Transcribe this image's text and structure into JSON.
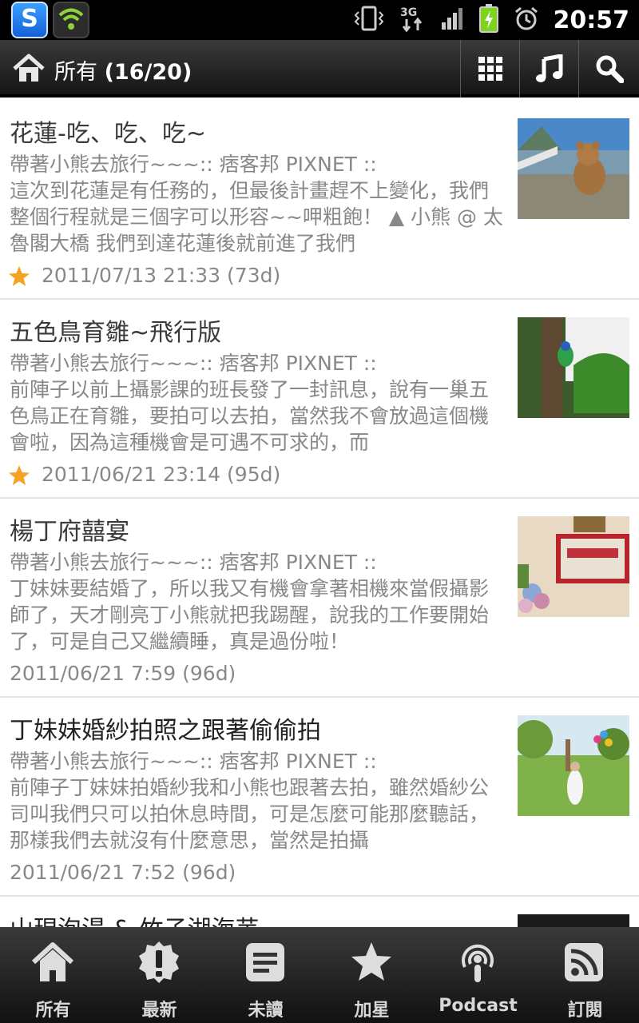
{
  "status_bar": {
    "time": "20:57",
    "network": "3G"
  },
  "header": {
    "title_prefix": "所有",
    "title_count": "(16/20)"
  },
  "articles": [
    {
      "title": "花蓮-吃、吃、吃~",
      "source": "帶著小熊去旅行~~~:: 痞客邦 PIXNET ::",
      "summary": "這次到花蓮是有任務的，但最後計畫趕不上變化，我們整個行程就是三個字可以形容~~呷粗飽！ ▲ 小熊 @ 太魯閣大橋 我們到達花蓮後就前進了我們",
      "date": "2011/07/13 21:33 (73d)",
      "starred": true
    },
    {
      "title": "五色鳥育雛~飛行版",
      "source": "帶著小熊去旅行~~~:: 痞客邦 PIXNET ::",
      "summary": "前陣子以前上攝影課的班長發了一封訊息，說有一巢五色鳥正在育雛，要拍可以去拍，當然我不會放過這個機會啦，因為這種機會是可遇不可求的，而",
      "date": "2011/06/21 23:14 (95d)",
      "starred": true
    },
    {
      "title": "楊丁府囍宴",
      "source": "帶著小熊去旅行~~~:: 痞客邦 PIXNET ::",
      "summary": "丁妹妹要結婚了，所以我又有機會拿著相機來當假攝影師了，天才剛亮丁小熊就把我踢醒，說我的工作要開始了，可是自己又繼續睡，真是過份啦！",
      "date": "2011/06/21 7:59 (96d)",
      "starred": false
    },
    {
      "title": "丁妹妹婚紗拍照之跟著偷偷拍",
      "source": "帶著小熊去旅行~~~:: 痞客邦 PIXNET ::",
      "summary": "前陣子丁妹妹拍婚紗我和小熊也跟著去拍，雖然婚紗公司叫我們只可以拍休息時間，可是怎麼可能那麼聽話，那樣我們去就沒有什麼意思，當然是拍攝",
      "date": "2011/06/21 7:52 (96d)",
      "starred": false
    },
    {
      "title": "山現泡湯 & 竹子湖海芋"
    }
  ],
  "bottom_nav": [
    {
      "label": "所有",
      "icon": "home-icon"
    },
    {
      "label": "最新",
      "icon": "alert-badge-icon"
    },
    {
      "label": "未讀",
      "icon": "document-icon"
    },
    {
      "label": "加星",
      "icon": "star-icon"
    },
    {
      "label": "Podcast",
      "icon": "podcast-icon"
    },
    {
      "label": "訂閱",
      "icon": "rss-icon"
    }
  ],
  "colors": {
    "star": "#f4a423",
    "bar_dark": "#151515",
    "battery": "#7ed321"
  }
}
